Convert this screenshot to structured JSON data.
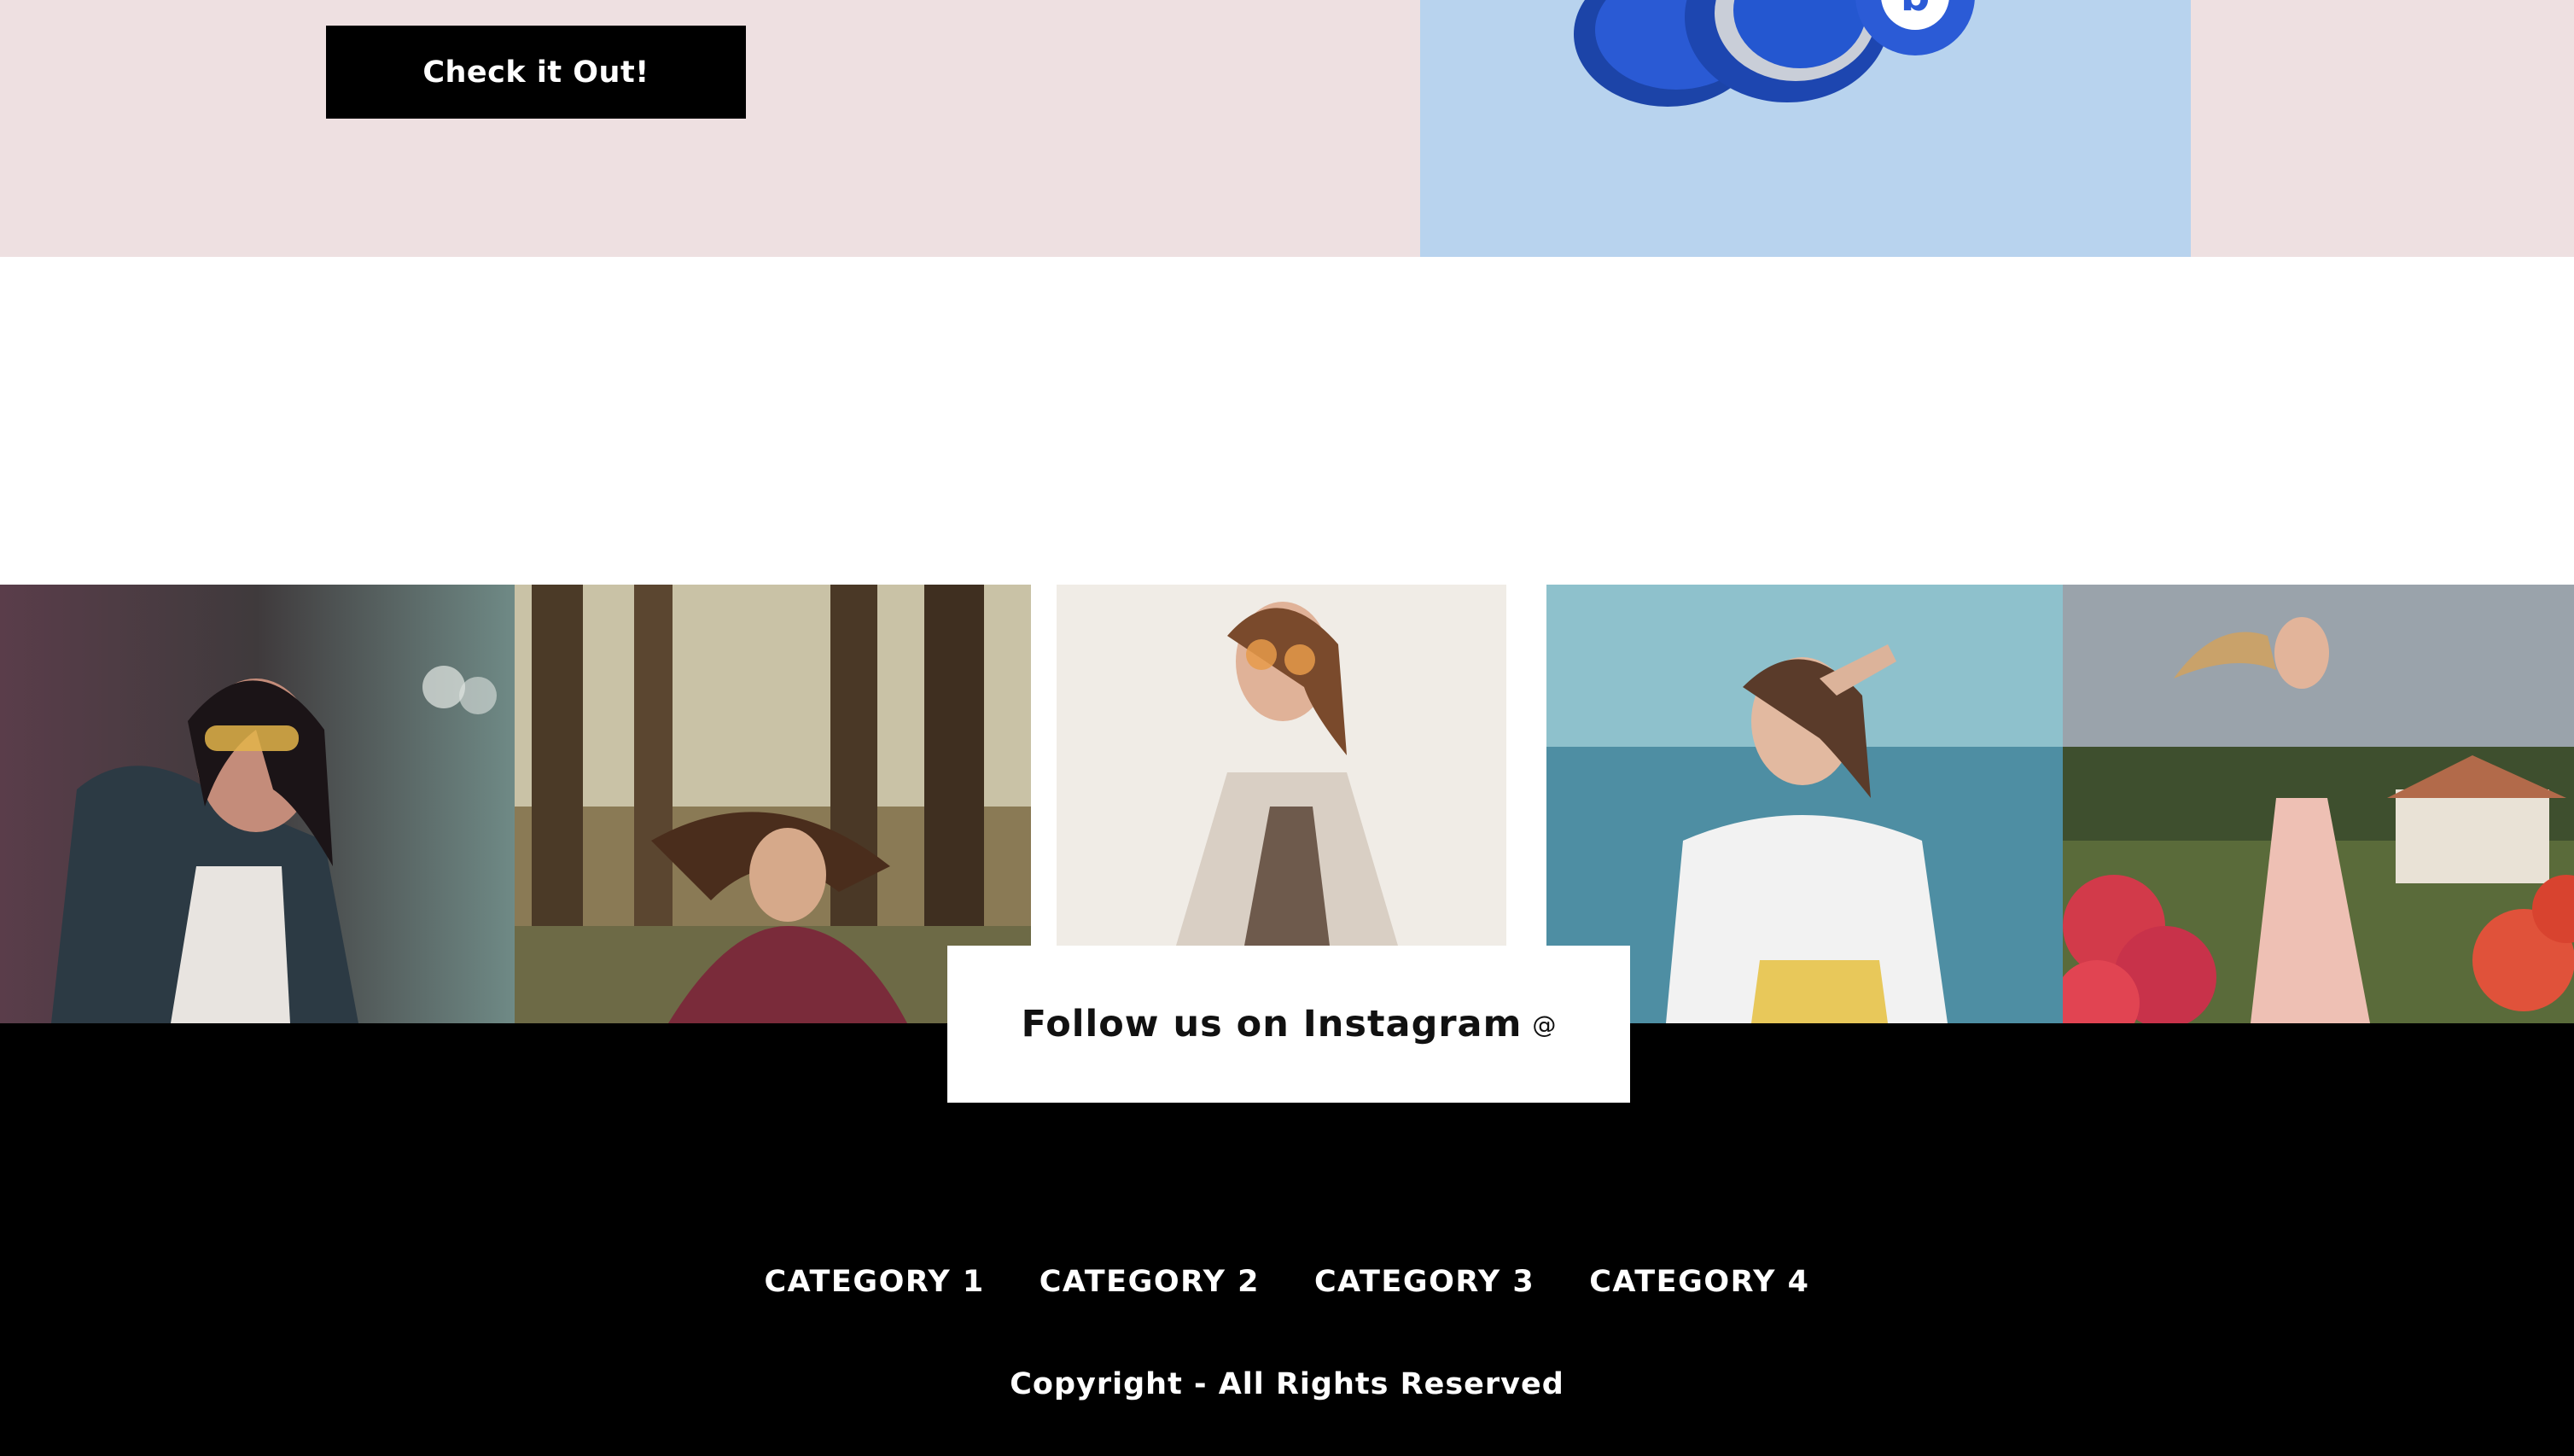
{
  "hero": {
    "cta_label": "Check it Out!",
    "background_color": "#eee0e1",
    "image_panel_color": "#b8d3ee",
    "image_icon": "headphones-image"
  },
  "instagram": {
    "follow_label": "Follow us on Instagram",
    "follow_icon_glyph": "@",
    "photos": [
      {
        "name": "woman-denim-jacket-sunglasses-photo"
      },
      {
        "name": "woman-forest-hair-flip-photo"
      },
      {
        "name": "woman-orange-sunglasses-photo"
      },
      {
        "name": "woman-white-tee-by-water-photo"
      },
      {
        "name": "woman-pink-dress-flowers-photo"
      }
    ]
  },
  "footer": {
    "nav": [
      {
        "label": "CATEGORY 1"
      },
      {
        "label": "CATEGORY 2"
      },
      {
        "label": "CATEGORY 3"
      },
      {
        "label": "CATEGORY 4"
      }
    ],
    "copyright": "Copyright - All Rights Reserved",
    "background_color": "#000000"
  }
}
